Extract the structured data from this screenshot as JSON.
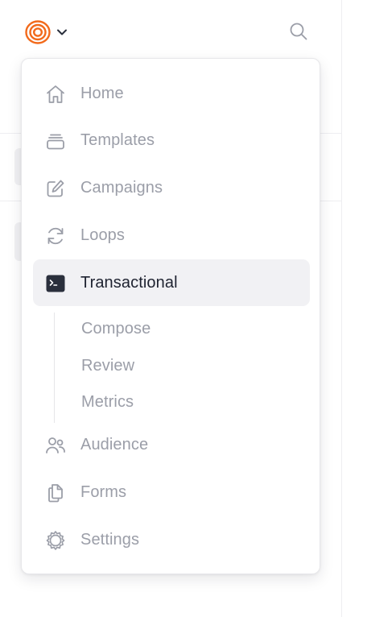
{
  "colors": {
    "brand": "#f26a1b",
    "text_muted": "#9b9ea8",
    "text_active": "#1e2230",
    "active_bg": "#f1f1f4",
    "active_icon_bg": "#2a2f3c"
  },
  "topbar": {
    "logo_icon": "brand-logo-icon",
    "dropdown_icon": "chevron-down-icon",
    "search_icon": "search-icon"
  },
  "menu": {
    "items": [
      {
        "label": "Home",
        "icon": "home-icon"
      },
      {
        "label": "Templates",
        "icon": "templates-icon"
      },
      {
        "label": "Campaigns",
        "icon": "pencil-square-icon"
      },
      {
        "label": "Loops",
        "icon": "refresh-icon"
      },
      {
        "label": "Transactional",
        "icon": "terminal-icon",
        "active": true
      }
    ],
    "subitems": [
      {
        "label": "Compose"
      },
      {
        "label": "Review"
      },
      {
        "label": "Metrics"
      }
    ],
    "bottom_items": [
      {
        "label": "Audience",
        "icon": "users-icon"
      },
      {
        "label": "Forms",
        "icon": "documents-icon"
      },
      {
        "label": "Settings",
        "icon": "gear-icon"
      }
    ]
  }
}
